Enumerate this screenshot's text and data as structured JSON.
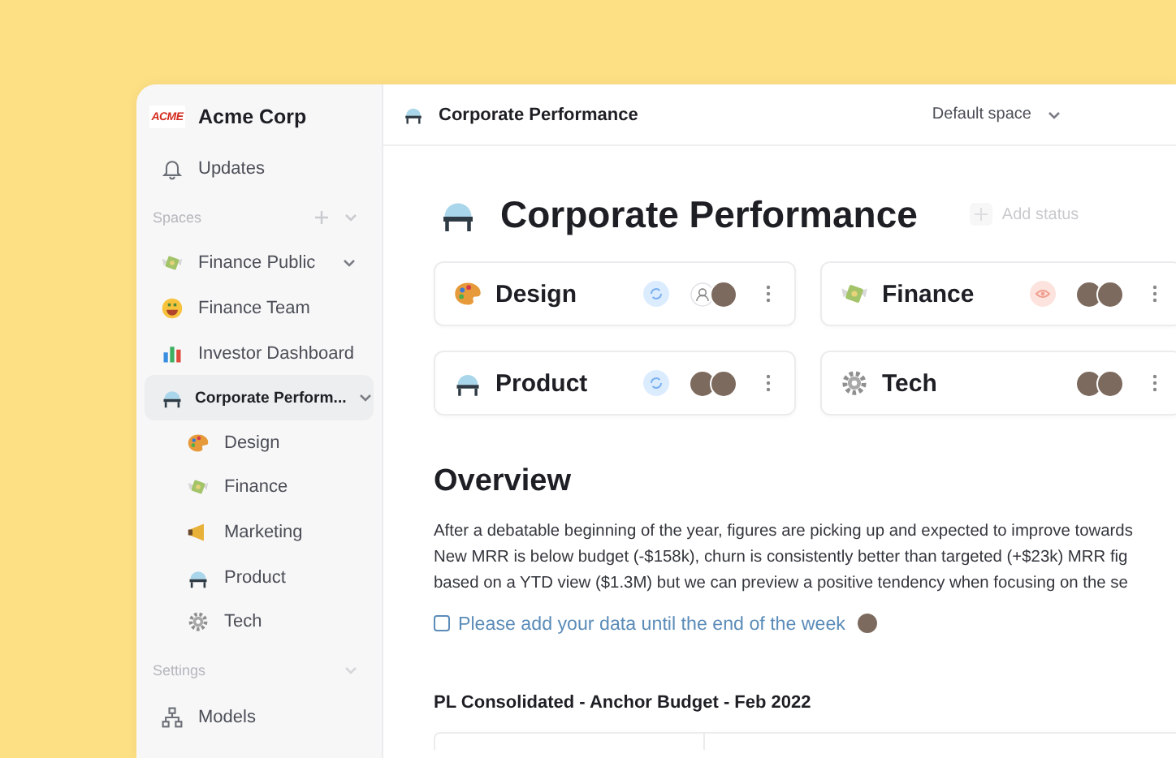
{
  "brand": {
    "logo_text": "ACME",
    "name": "Acme Corp"
  },
  "sidebar": {
    "top_items": [
      {
        "label": "Updates",
        "kind": "bell"
      }
    ],
    "spaces_label": "Spaces",
    "spaces": [
      {
        "label": "Finance Public",
        "kind": "money",
        "chevron": true,
        "selected": false
      },
      {
        "label": "Finance Team",
        "kind": "grin",
        "chevron": false,
        "selected": false
      },
      {
        "label": "Investor Dashboard",
        "kind": "chart",
        "chevron": false,
        "selected": false
      },
      {
        "label": "Corporate Perform...",
        "kind": "dome",
        "chevron": true,
        "selected": true,
        "children": [
          {
            "label": "Design",
            "kind": "palette",
            "selected": false
          },
          {
            "label": "Finance",
            "kind": "money",
            "selected": false
          },
          {
            "label": "Marketing",
            "kind": "megaphone",
            "selected": false
          },
          {
            "label": "Product",
            "kind": "dome",
            "selected": false
          },
          {
            "label": "Tech",
            "kind": "gear",
            "selected": false
          }
        ]
      }
    ],
    "settings_label": "Settings",
    "settings_items": [
      {
        "label": "Models",
        "kind": "models"
      }
    ]
  },
  "topbar": {
    "title": "Corporate Performance",
    "space_selector": "Default space"
  },
  "page": {
    "title": "Corporate Performance",
    "add_status": "Add status"
  },
  "cards": [
    {
      "name": "Design",
      "kind": "palette",
      "badge": {
        "kind": "sync"
      },
      "avatars": [
        {
          "kind": "placeholder"
        },
        {
          "kind": "photo"
        }
      ]
    },
    {
      "name": "Finance",
      "kind": "money",
      "badge": {
        "kind": "eye"
      },
      "avatars": [
        {
          "kind": "photo"
        },
        {
          "kind": "photo"
        }
      ]
    },
    {
      "name": "Product",
      "kind": "dome",
      "badge": {
        "kind": "sync"
      },
      "avatars": [
        {
          "kind": "photo"
        },
        {
          "kind": "photo"
        }
      ]
    },
    {
      "name": "Tech",
      "kind": "gear",
      "avatars": [
        {
          "kind": "photo"
        },
        {
          "kind": "photo"
        }
      ]
    }
  ],
  "overview": {
    "heading": "Overview",
    "paragraph_lines": [
      "After a debatable beginning of the year, figures are picking up and expected to improve towards",
      "New MRR is below budget (-$158k), churn is consistently better than targeted (+$23k) MRR fig",
      "based on a YTD view ($1.3M) but we can preview a positive tendency when focusing on the se"
    ],
    "task": {
      "text": "Please add your data until the end of the week",
      "checked": false
    },
    "table_title": "PL Consolidated - Anchor Budget  - Feb 2022"
  }
}
